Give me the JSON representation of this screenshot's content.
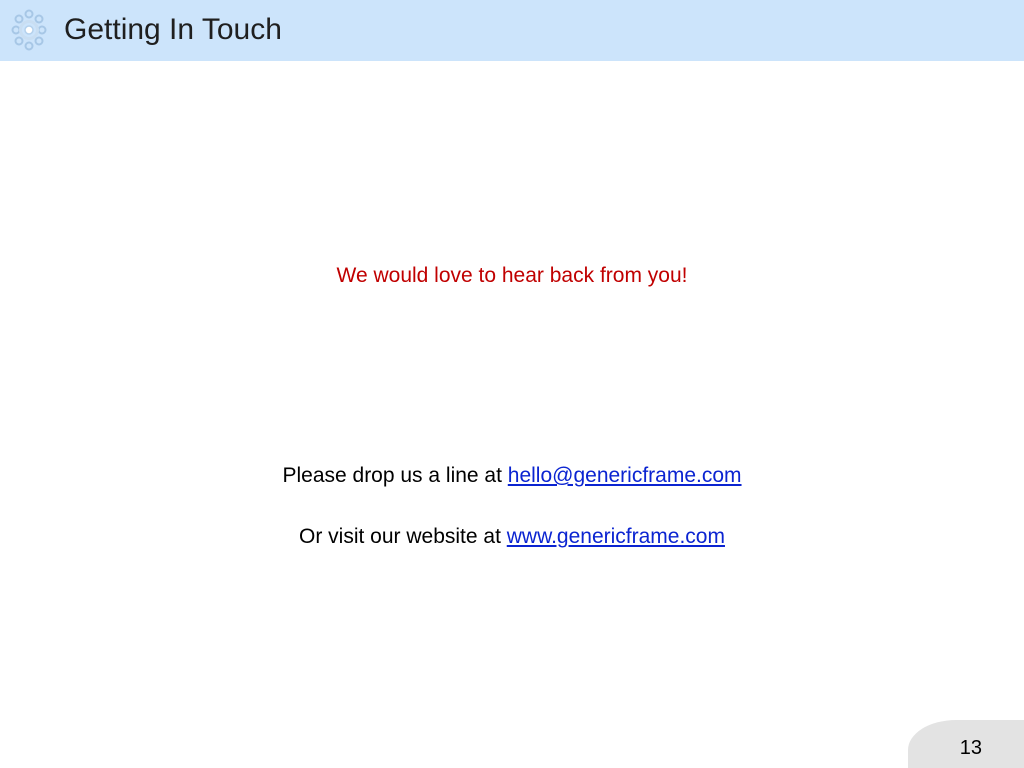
{
  "header": {
    "title": "Getting In Touch",
    "background": "#cce4fb",
    "logo_icon": "gear-ring-logo-icon"
  },
  "tagline": {
    "text": "We would love to hear back from you!",
    "color": "#c00000"
  },
  "contact": {
    "email_prefix": "Please drop us a line at ",
    "email": "hello@genericframe.com",
    "website_prefix": "Or visit our website at ",
    "website": "www.genericframe.com",
    "link_color": "#0b24d1"
  },
  "footer": {
    "page_number": "13"
  }
}
